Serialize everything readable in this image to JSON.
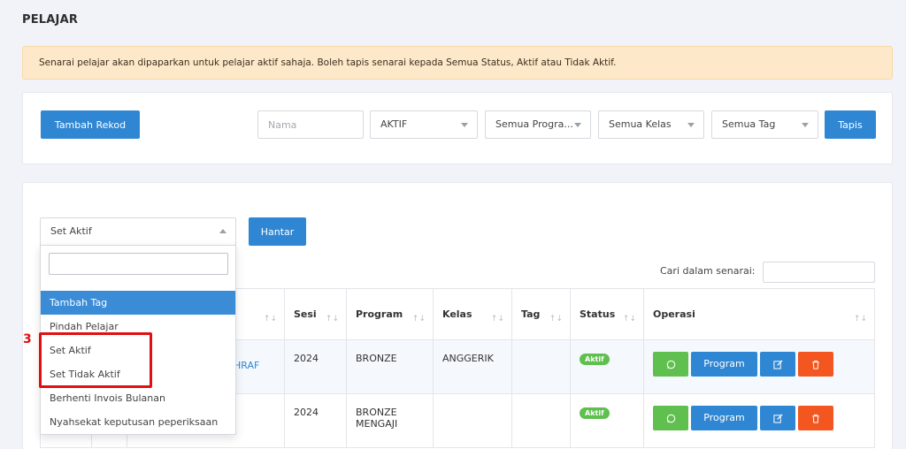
{
  "page": {
    "title": "PELAJAR"
  },
  "alert": {
    "text": "Senarai pelajar akan dipaparkan untuk pelajar aktif sahaja. Boleh tapis senarai kepada Semua Status, Aktif atau Tidak Aktif."
  },
  "filter": {
    "add_button": "Tambah Rekod",
    "name_placeholder": "Nama",
    "status_select": "AKTIF",
    "program_select": "Semua Progra...",
    "class_select": "Semua Kelas",
    "tag_select": "Semua Tag",
    "filter_button": "Tapis"
  },
  "bulk": {
    "action_select": "Set Aktif",
    "submit_button": "Hantar",
    "search_label": "Cari dalam senarai:"
  },
  "dropdown": {
    "options": [
      "Tambah Tag",
      "Pindah Pelajar",
      "Set Aktif",
      "Set Tidak Aktif",
      "Berhenti Invois Bulanan",
      "Nyahsekat keputusan peperiksaan"
    ]
  },
  "annotation": {
    "step": "3"
  },
  "table": {
    "columns": [
      "Sesi",
      "Program",
      "Kelas",
      "Tag",
      "Status",
      "Operasi"
    ],
    "sort_glyph": "↑↓",
    "rows": [
      {
        "name_fragment": "HRAF",
        "sesi": "2024",
        "program": "BRONZE",
        "kelas": "ANGGERIK",
        "tag": "",
        "status": "Aktif"
      },
      {
        "name_fragment": "",
        "sesi": "2024",
        "program": "BRONZE MENGAJI",
        "kelas": "",
        "tag": "",
        "status": "Aktif"
      }
    ],
    "operations": {
      "program_button": "Program"
    }
  },
  "colors": {
    "primary": "#2f86d3",
    "success": "#5fbf4f",
    "danger": "#f3561f",
    "highlight": "#e01010"
  }
}
